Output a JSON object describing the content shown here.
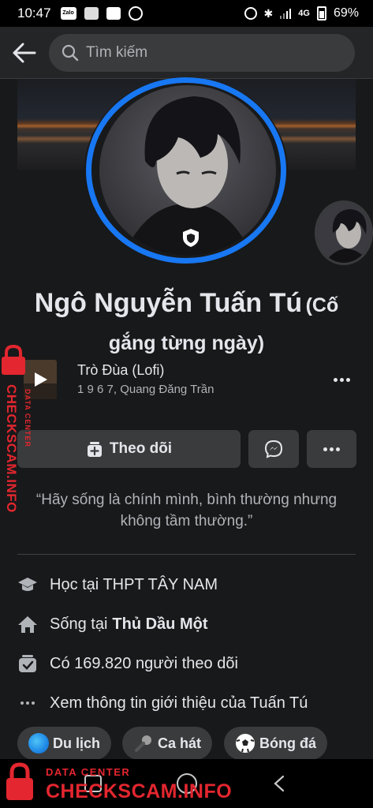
{
  "status_bar": {
    "time": "10:47",
    "zalo_label": "Zalo",
    "network": "4G",
    "battery": "69%"
  },
  "search": {
    "placeholder": "Tìm kiếm"
  },
  "profile": {
    "name": "Ngô Nguyễn Tuấn Tú",
    "nickname": "(Cố gắng từng ngày)"
  },
  "music": {
    "title": "Trò Đùa (Lofi)",
    "artist": "1 9 6 7, Quang Đăng Trần"
  },
  "actions": {
    "follow_label": "Theo dõi"
  },
  "bio": "“Hãy sống là chính mình, bình thường nhưng không tầm thường.”",
  "intro": {
    "education": "Học tại THPT TÂY NAM",
    "lives_prefix": "Sống tại",
    "lives_place": "Thủ Dầu Một",
    "followers": "Có 169.820 người theo dõi",
    "see_more": "Xem thông tin giới thiệu của Tuấn Tú"
  },
  "interests": [
    {
      "label": "Du lịch",
      "icon": "globe-icon"
    },
    {
      "label": "Ca hát",
      "icon": "microphone-icon"
    },
    {
      "label": "Bóng đá",
      "icon": "soccer-ball-icon"
    }
  ],
  "watermark": {
    "small": "DATA CENTER",
    "big": "CHECKSCAM.INFO",
    "color": "#e3262f"
  },
  "colors": {
    "accent": "#1877f2",
    "background": "#18191a",
    "surface": "#3a3b3c"
  }
}
